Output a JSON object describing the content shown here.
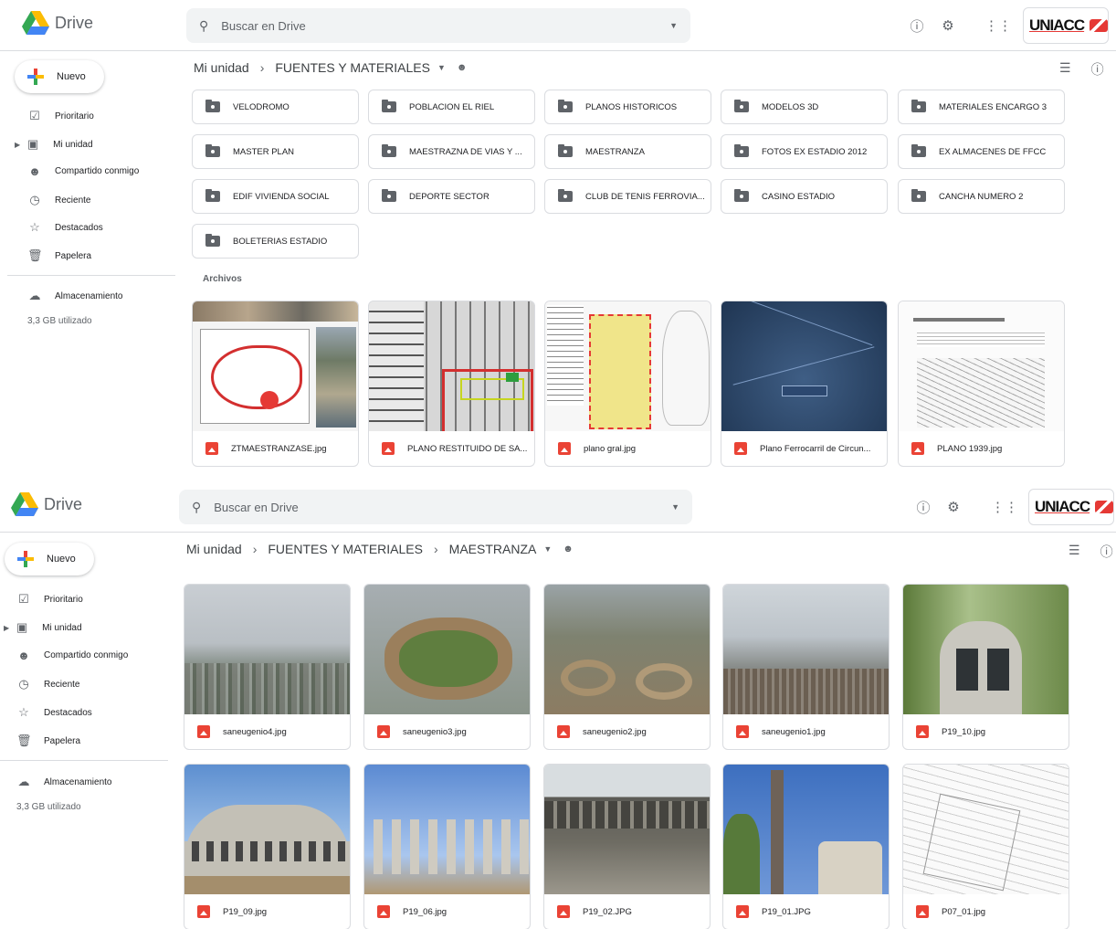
{
  "panel1": {
    "app_name": "Drive",
    "search_placeholder": "Buscar en Drive",
    "brand": "UNIACC",
    "new_button": "Nuevo",
    "nav": [
      "Prioritario",
      "Mi unidad",
      "Compartido conmigo",
      "Reciente",
      "Destacados",
      "Papelera"
    ],
    "storage_label": "Almacenamiento",
    "storage_used": "3,3 GB utilizado",
    "breadcrumb": [
      "Mi unidad",
      "FUENTES Y MATERIALES"
    ],
    "folders": [
      "VELODROMO",
      "POBLACION EL RIEL",
      "PLANOS HISTORICOS",
      "MODELOS 3D",
      "MATERIALES ENCARGO 3",
      "MASTER PLAN",
      "MAESTRAZNA DE VIAS Y ...",
      "MAESTRANZA",
      "FOTOS EX ESTADIO 2012",
      "EX ALMACENES DE FFCC",
      "EDIF VIVIENDA SOCIAL",
      "DEPORTE SECTOR",
      "CLUB DE TENIS FERROVIA...",
      "CASINO ESTADIO",
      "CANCHA NUMERO 2",
      "BOLETERIAS ESTADIO"
    ],
    "files_label": "Archivos",
    "files": [
      "ZTMAESTRANZASE.jpg",
      "PLANO RESTITUIDO DE SA...",
      "plano gral.jpg",
      "Plano Ferrocarril de Circun...",
      "PLANO 1939.jpg"
    ]
  },
  "panel2": {
    "app_name": "Drive",
    "search_placeholder": "Buscar en Drive",
    "brand": "UNIACC",
    "new_button": "Nuevo",
    "nav": [
      "Prioritario",
      "Mi unidad",
      "Compartido conmigo",
      "Reciente",
      "Destacados",
      "Papelera"
    ],
    "storage_label": "Almacenamiento",
    "storage_used": "3,3 GB utilizado",
    "breadcrumb": [
      "Mi unidad",
      "FUENTES Y MATERIALES",
      "MAESTRANZA"
    ],
    "files": [
      "saneugenio4.jpg",
      "saneugenio3.jpg",
      "saneugenio2.jpg",
      "saneugenio1.jpg",
      "P19_10.jpg",
      "P19_09.jpg",
      "P19_06.jpg",
      "P19_02.JPG",
      "P19_01.JPG",
      "P07_01.jpg"
    ]
  },
  "colors": {
    "accent_red": "#ea4335",
    "border": "#dadce0",
    "search_bg": "#f1f3f4"
  },
  "icons": [
    "search-icon",
    "help-icon",
    "gear-icon",
    "apps-icon",
    "list-view-icon",
    "info-icon",
    "folder-icon",
    "image-file-icon"
  ]
}
